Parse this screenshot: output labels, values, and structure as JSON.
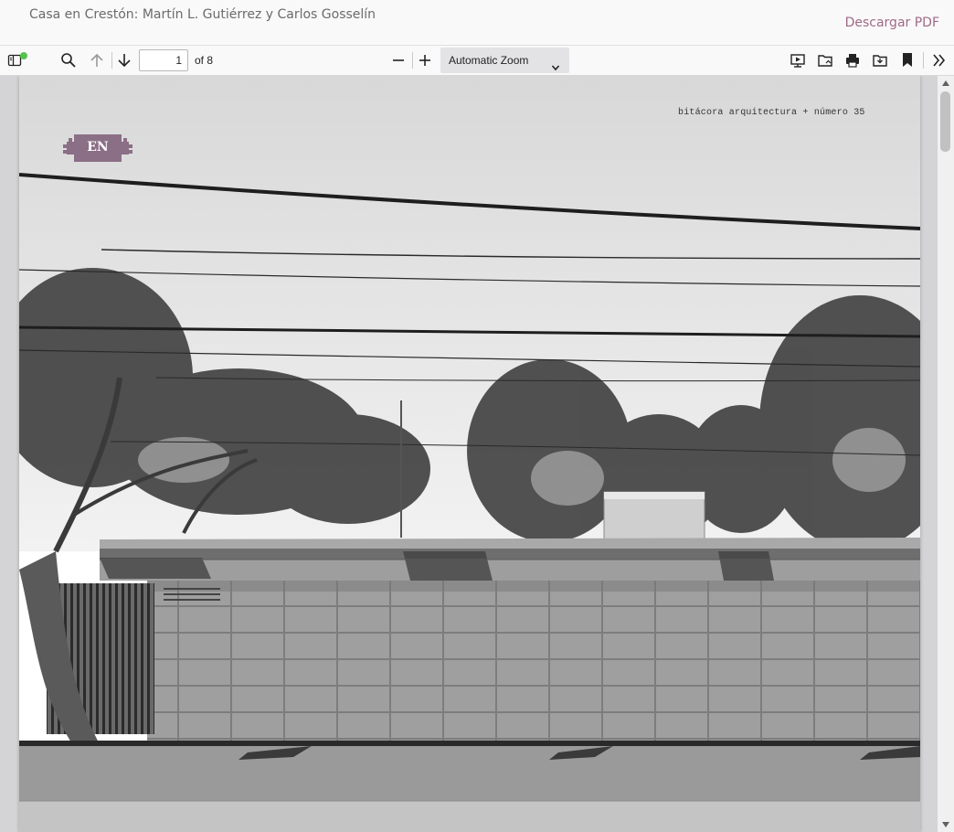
{
  "header": {
    "title": "Casa en Crestón: Martín L. Gutiérrez y Carlos Gosselín",
    "download_label": "Descargar PDF",
    "accent_color": "#a06a86"
  },
  "toolbar": {
    "page_number": "1",
    "page_count_label": "of 8",
    "zoom_value": "Automatic Zoom",
    "icons": [
      "sidebar-toggle-icon",
      "search-icon",
      "previous-page-icon",
      "next-page-icon",
      "zoom-out-icon",
      "zoom-in-icon",
      "presentation-mode-icon",
      "open-file-icon",
      "print-icon",
      "download-icon",
      "bookmark-icon",
      "tools-icon"
    ]
  },
  "document_page": {
    "header_text": "bitácora arquitectura + número 35",
    "language_badge": "EN",
    "badge_color": "#8b6f86"
  }
}
